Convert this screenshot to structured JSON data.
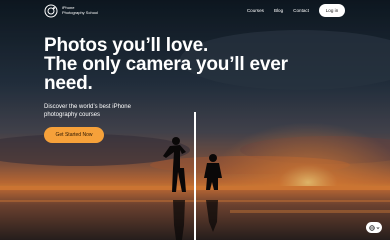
{
  "brand": {
    "line1": "iPhone",
    "line2": "Photography School"
  },
  "nav": {
    "links": [
      "Courses",
      "Blog",
      "Contact"
    ],
    "login_label": "Log in"
  },
  "hero": {
    "title_lines": [
      "Photos you’ll love.",
      "The only camera you’ll ever",
      "need."
    ],
    "subtitle": "Discover the world’s best iPhone photography courses",
    "cta_label": "Get Started Now"
  },
  "icons": {
    "logo": "camera-lens-icon",
    "language": "globe-icon",
    "language_caret": "chevron-down-icon"
  },
  "colors": {
    "accent": "#f6a13a",
    "text": "#ffffff"
  }
}
